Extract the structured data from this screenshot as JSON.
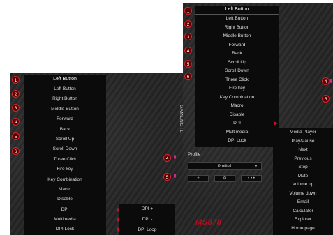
{
  "left": {
    "title": "Left Button",
    "items": [
      "Left Button",
      "Right Button",
      "Middle Button",
      "Forward",
      "Back",
      "Scroll Up",
      "Scroll Down",
      "Three Click",
      "Fire key",
      "Key Combination",
      "Macro",
      "Disable",
      "DPI",
      "Multimedia",
      "DPI Lock"
    ],
    "badges": [
      "1",
      "2",
      "3",
      "4",
      "5",
      "6"
    ],
    "side_badges": [
      "4",
      "5"
    ],
    "dpi_submenu": [
      "DPI +",
      "DPI -",
      "DPI Loop"
    ],
    "vertical_label": "GAMENOTE"
  },
  "right": {
    "title": "Left Button",
    "items": [
      "Left Button",
      "Right Button",
      "Middle Button",
      "Forward",
      "Back",
      "Scroll Up",
      "Scroll Down",
      "Three Click",
      "Fire key",
      "Key Combination",
      "Macro",
      "Disable",
      "DPI",
      "Multimedia",
      "DPI Lock"
    ],
    "badges": [
      "1",
      "2",
      "3",
      "4",
      "5",
      "6"
    ],
    "side_badges": [
      "4",
      "5"
    ],
    "profile": {
      "label": "Profile",
      "selected": "Profile1",
      "buttons": [
        "+",
        "⊖",
        "• • •"
      ]
    },
    "brand": "MS878",
    "multimedia_submenu": [
      "Media Player",
      "Play/Pause",
      "Next",
      "Previous",
      "Stop",
      "Mute",
      "Volume up",
      "Volume down",
      "Email",
      "Calculator",
      "Explorer",
      "Home page"
    ]
  },
  "colors": {
    "accent": "#c8102e",
    "menu_bg": "#0b0b0b",
    "panel_bg": "#262626"
  },
  "icons": {
    "arrow": "triangle-right-icon"
  }
}
